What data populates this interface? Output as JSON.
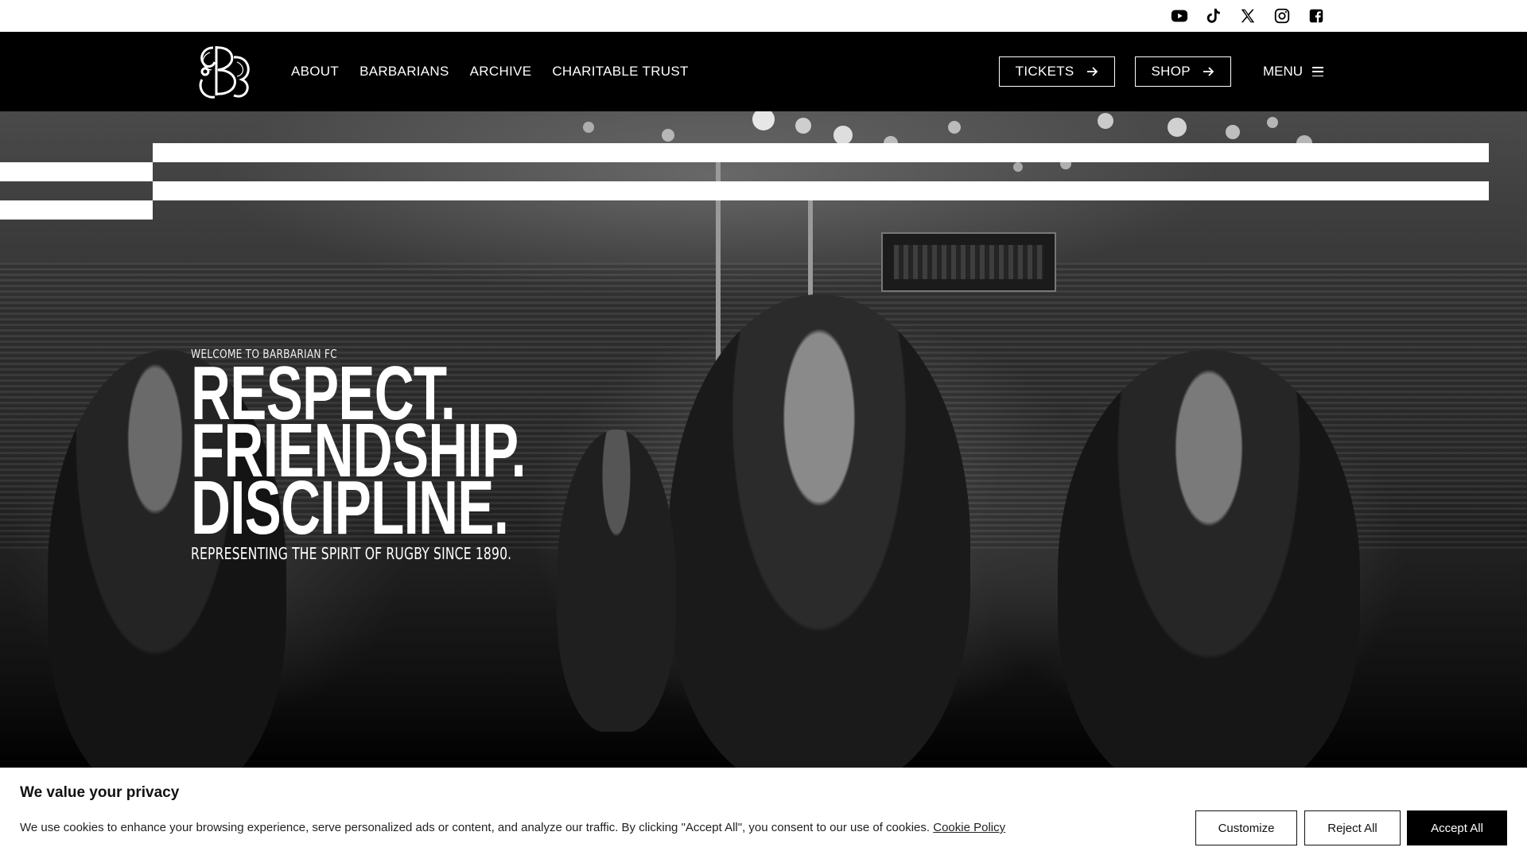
{
  "social": {
    "icons": [
      "youtube-icon",
      "tiktok-icon",
      "x-icon",
      "instagram-icon",
      "facebook-icon"
    ]
  },
  "nav": {
    "links": [
      "ABOUT",
      "BARBARIANS",
      "ARCHIVE",
      "CHARITABLE TRUST"
    ],
    "tickets_label": "TICKETS",
    "shop_label": "SHOP",
    "menu_label": "MENU"
  },
  "hero": {
    "eyebrow": "WELCOME TO BARBARIAN FC",
    "headline": [
      "RESPECT.",
      "FRIENDSHIP.",
      "DISCIPLINE."
    ],
    "tagline": "REPRESENTING THE SPIRIT OF RUGBY SINCE 1890."
  },
  "cookie": {
    "title": "We value your privacy",
    "text": "We use cookies to enhance your browsing experience, serve personalized ads or content, and analyze our traffic. By clicking \"Accept All\", you consent to our use of cookies.",
    "policy_link": "Cookie Policy",
    "customize_label": "Customize",
    "reject_label": "Reject All",
    "accept_label": "Accept All"
  },
  "colors": {
    "background": "#000000",
    "text": "#ffffff",
    "banner": "#ffffff",
    "accept": "#000000"
  }
}
